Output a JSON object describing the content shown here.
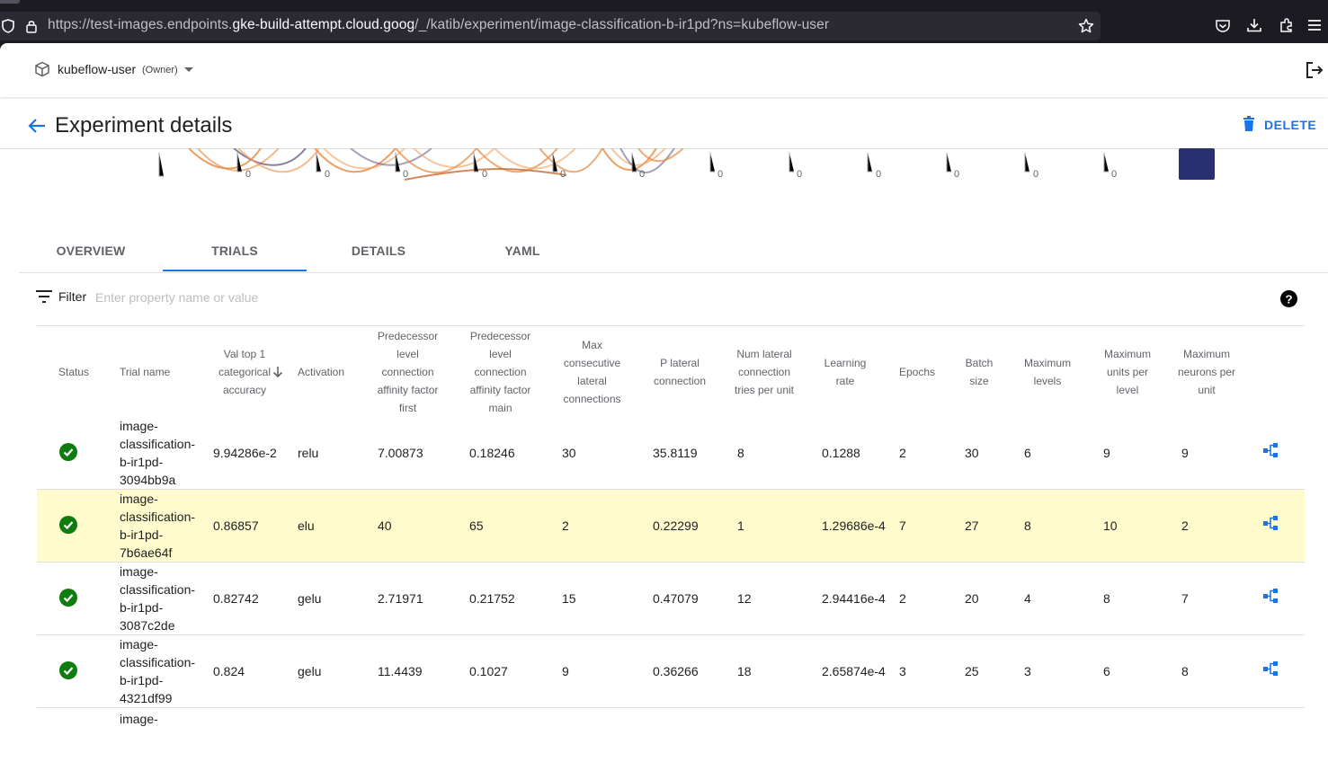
{
  "browser": {
    "url_prefix": "https://test-images.endpoints.",
    "url_host": "gke-build-attempt.cloud.goog",
    "url_suffix": "/_/katib/experiment/image-classification-b-ir1pd?ns=kubeflow-user"
  },
  "header": {
    "namespace": "kubeflow-user",
    "role": "(Owner)"
  },
  "page": {
    "title": "Experiment details",
    "delete_label": "DELETE"
  },
  "chart": {
    "tick_label": "0"
  },
  "tabs": [
    {
      "label": "OVERVIEW"
    },
    {
      "label": "TRIALS"
    },
    {
      "label": "DETAILS"
    },
    {
      "label": "YAML"
    }
  ],
  "active_tab": "TRIALS",
  "filter": {
    "label": "Filter",
    "placeholder": "Enter property name or value"
  },
  "table": {
    "columns": [
      {
        "label": "Status"
      },
      {
        "label": "Trial name"
      },
      {
        "label": "Val top 1 categorical accuracy",
        "sort": "desc"
      },
      {
        "label": "Activation"
      },
      {
        "label": "Predecessor level connection affinity factor first"
      },
      {
        "label": "Predecessor level connection affinity factor main"
      },
      {
        "label": "Max consecutive lateral connections"
      },
      {
        "label": "P lateral connection"
      },
      {
        "label": "Num lateral connection tries per unit"
      },
      {
        "label": "Learning rate"
      },
      {
        "label": "Epochs"
      },
      {
        "label": "Batch size"
      },
      {
        "label": "Maximum levels"
      },
      {
        "label": "Maximum units per level"
      },
      {
        "label": "Maximum neurons per unit"
      }
    ],
    "rows": [
      {
        "status": "Succeeded",
        "trial_name": "image-classification-b-ir1pd-3094bb9a",
        "trial_lines": [
          "image-",
          "classification-",
          "b-ir1pd-",
          "3094bb9a"
        ],
        "values": [
          "9.94286e-2",
          "relu",
          "7.00873",
          "0.18246",
          "30",
          "35.8119",
          "8",
          "0.1288",
          "2",
          "30",
          "6",
          "9",
          "9"
        ],
        "highlighted": false
      },
      {
        "status": "Succeeded",
        "trial_name": "image-classification-b-ir1pd-7b6ae64f",
        "trial_lines": [
          "image-",
          "classification-",
          "b-ir1pd-",
          "7b6ae64f"
        ],
        "values": [
          "0.86857",
          "elu",
          "40",
          "65",
          "2",
          "0.22299",
          "1",
          "1.29686e-4",
          "7",
          "27",
          "8",
          "10",
          "2"
        ],
        "highlighted": true
      },
      {
        "status": "Succeeded",
        "trial_name": "image-classification-b-ir1pd-3087c2de",
        "trial_lines": [
          "image-",
          "classification-",
          "b-ir1pd-",
          "3087c2de"
        ],
        "values": [
          "0.82742",
          "gelu",
          "2.71971",
          "0.21752",
          "15",
          "0.47079",
          "12",
          "2.94416e-4",
          "2",
          "20",
          "4",
          "8",
          "7"
        ],
        "highlighted": false
      },
      {
        "status": "Succeeded",
        "trial_name": "image-classification-b-ir1pd-4321df99",
        "trial_lines": [
          "image-",
          "classification-",
          "b-ir1pd-",
          "4321df99"
        ],
        "values": [
          "0.824",
          "gelu",
          "11.4439",
          "0.1027",
          "9",
          "0.36266",
          "18",
          "2.65874e-4",
          "3",
          "25",
          "3",
          "6",
          "8"
        ],
        "highlighted": false
      },
      {
        "status": "",
        "trial_name": "image-",
        "trial_lines": [
          "image-"
        ],
        "values": [],
        "highlighted": false
      }
    ]
  },
  "colors": {
    "accent": "#1a73e8",
    "success": "#0e7c0e",
    "highlight_row": "#fffbcc",
    "chart_orange": "#e8863a",
    "chart_purple": "#6b5f8c",
    "chart_navy": "#283070"
  }
}
